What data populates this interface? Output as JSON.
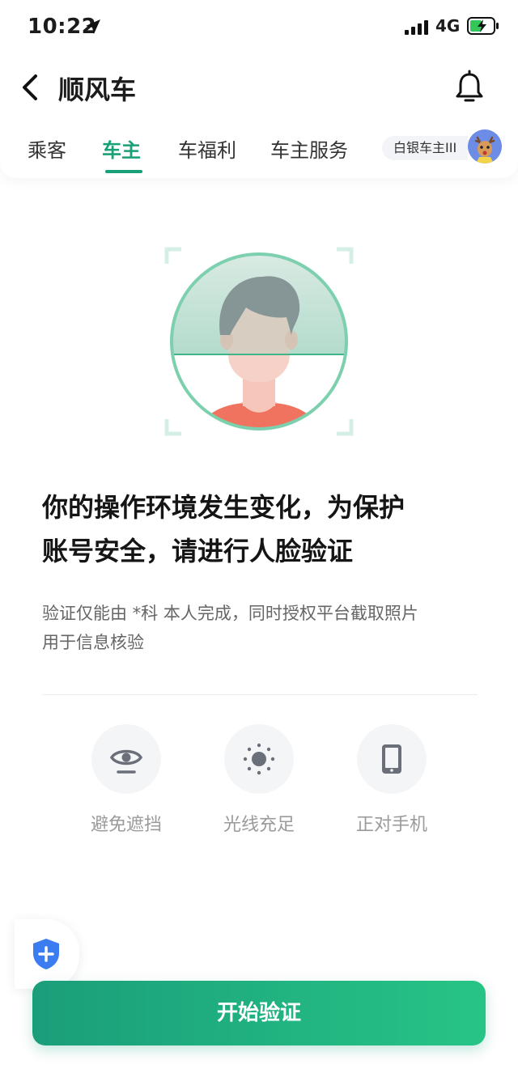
{
  "status_bar": {
    "time": "10:22",
    "network": "4G"
  },
  "header": {
    "title": "顺风车"
  },
  "tabs": [
    {
      "label": "乘客"
    },
    {
      "label": "车主"
    },
    {
      "label": "车福利"
    },
    {
      "label": "车主服务"
    }
  ],
  "active_tab_index": 1,
  "badge": {
    "label": "白银车主III"
  },
  "content": {
    "headline_line1": "你的操作环境发生变化，为保护",
    "headline_line2": "账号安全，请进行人脸验证",
    "desc_line1": "验证仅能由 *科 本人完成，同时授权平台截取照片",
    "desc_line2": "用于信息核验"
  },
  "tips": [
    {
      "label": "避免遮挡",
      "icon": "eye-icon"
    },
    {
      "label": "光线充足",
      "icon": "sun-icon"
    },
    {
      "label": "正对手机",
      "icon": "phone-icon"
    }
  ],
  "start_button": {
    "label": "开始验证"
  },
  "colors": {
    "accent": "#1aa077",
    "button_start": "#1a9e7a",
    "button_end": "#27c486"
  }
}
